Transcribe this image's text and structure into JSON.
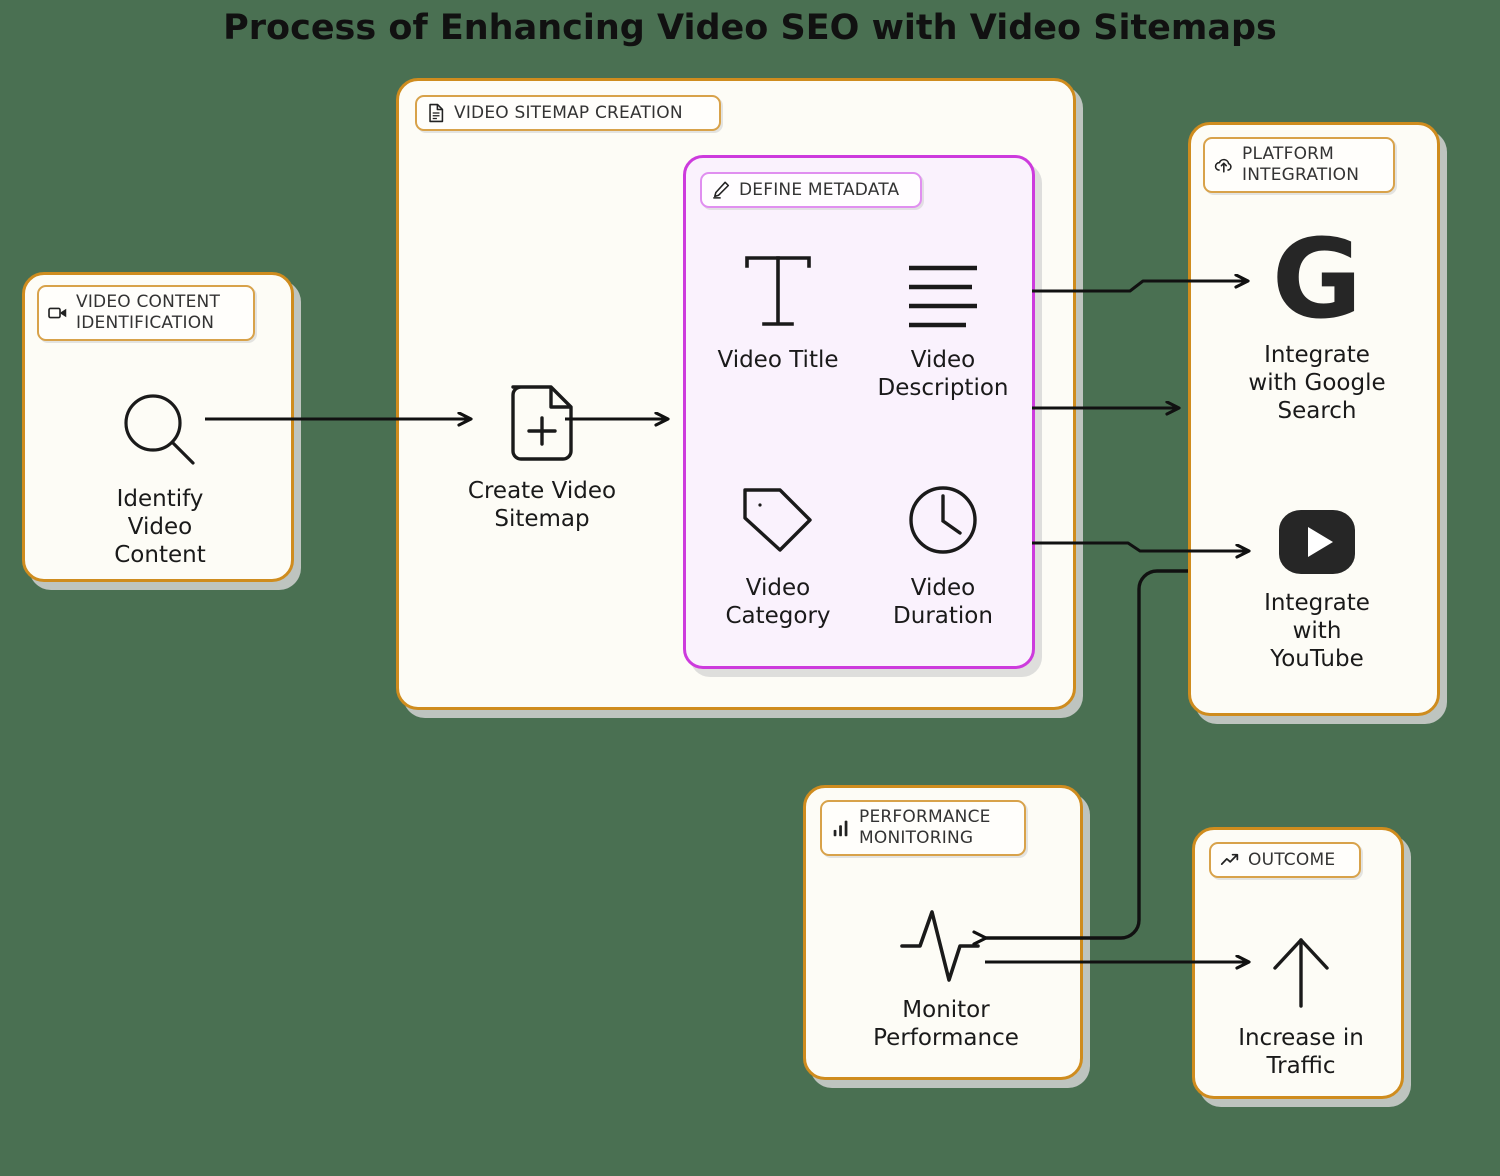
{
  "title": "Process of Enhancing Video SEO with Video Sitemaps",
  "colors": {
    "page_background": "#4a7052",
    "card_background": "#fdfcf6",
    "card_border": "#cf8c1e",
    "metadata_background": "#faf2fd",
    "metadata_border": "#cd3bdd",
    "text": "#1a1a1a",
    "connector": "#111111"
  },
  "containers": [
    {
      "id": "video-content-identification",
      "label": "VIDEO CONTENT\nIDENTIFICATION",
      "icon": "video-camera-icon"
    },
    {
      "id": "video-sitemap-creation",
      "label": "VIDEO SITEMAP CREATION",
      "icon": "document-icon"
    },
    {
      "id": "define-metadata",
      "label": "DEFINE METADATA",
      "icon": "pencil-icon"
    },
    {
      "id": "platform-integration",
      "label": "PLATFORM\nINTEGRATION",
      "icon": "cloud-upload-icon"
    },
    {
      "id": "performance-monitoring",
      "label": "PERFORMANCE\nMONITORING",
      "icon": "bar-chart-icon"
    },
    {
      "id": "outcome",
      "label": "OUTCOME",
      "icon": "trend-up-icon"
    }
  ],
  "nodes": [
    {
      "id": "identify-video-content",
      "label": "Identify\nVideo\nContent",
      "icon": "magnifier-icon",
      "container": "video-content-identification"
    },
    {
      "id": "create-video-sitemap",
      "label": "Create Video\nSitemap",
      "icon": "document-plus-icon",
      "container": "video-sitemap-creation"
    },
    {
      "id": "video-title",
      "label": "Video Title",
      "icon": "text-t-icon",
      "container": "define-metadata"
    },
    {
      "id": "video-description",
      "label": "Video\nDescription",
      "icon": "text-lines-icon",
      "container": "define-metadata"
    },
    {
      "id": "video-category",
      "label": "Video\nCategory",
      "icon": "tag-icon",
      "container": "define-metadata"
    },
    {
      "id": "video-duration",
      "label": "Video\nDuration",
      "icon": "clock-icon",
      "container": "define-metadata"
    },
    {
      "id": "integrate-with-google-search",
      "label": "Integrate\nwith Google\nSearch",
      "icon": "google-g-icon",
      "container": "platform-integration"
    },
    {
      "id": "integrate-with-youtube",
      "label": "Integrate\nwith\nYouTube",
      "icon": "youtube-icon",
      "container": "platform-integration"
    },
    {
      "id": "monitor-performance",
      "label": "Monitor\nPerformance",
      "icon": "pulse-icon",
      "container": "performance-monitoring"
    },
    {
      "id": "increase-in-traffic",
      "label": "Increase in\nTraffic",
      "icon": "arrow-up-icon",
      "container": "outcome"
    }
  ],
  "connections": [
    {
      "from": "identify-video-content",
      "to": "create-video-sitemap"
    },
    {
      "from": "create-video-sitemap",
      "to": "define-metadata"
    },
    {
      "from": "video-description",
      "to": "integrate-with-google-search"
    },
    {
      "from": "define-metadata",
      "to": "integrate-with-google-search"
    },
    {
      "from": "video-duration",
      "to": "integrate-with-youtube"
    },
    {
      "from": "integrate-with-youtube",
      "to": "monitor-performance"
    },
    {
      "from": "monitor-performance",
      "to": "increase-in-traffic"
    }
  ]
}
